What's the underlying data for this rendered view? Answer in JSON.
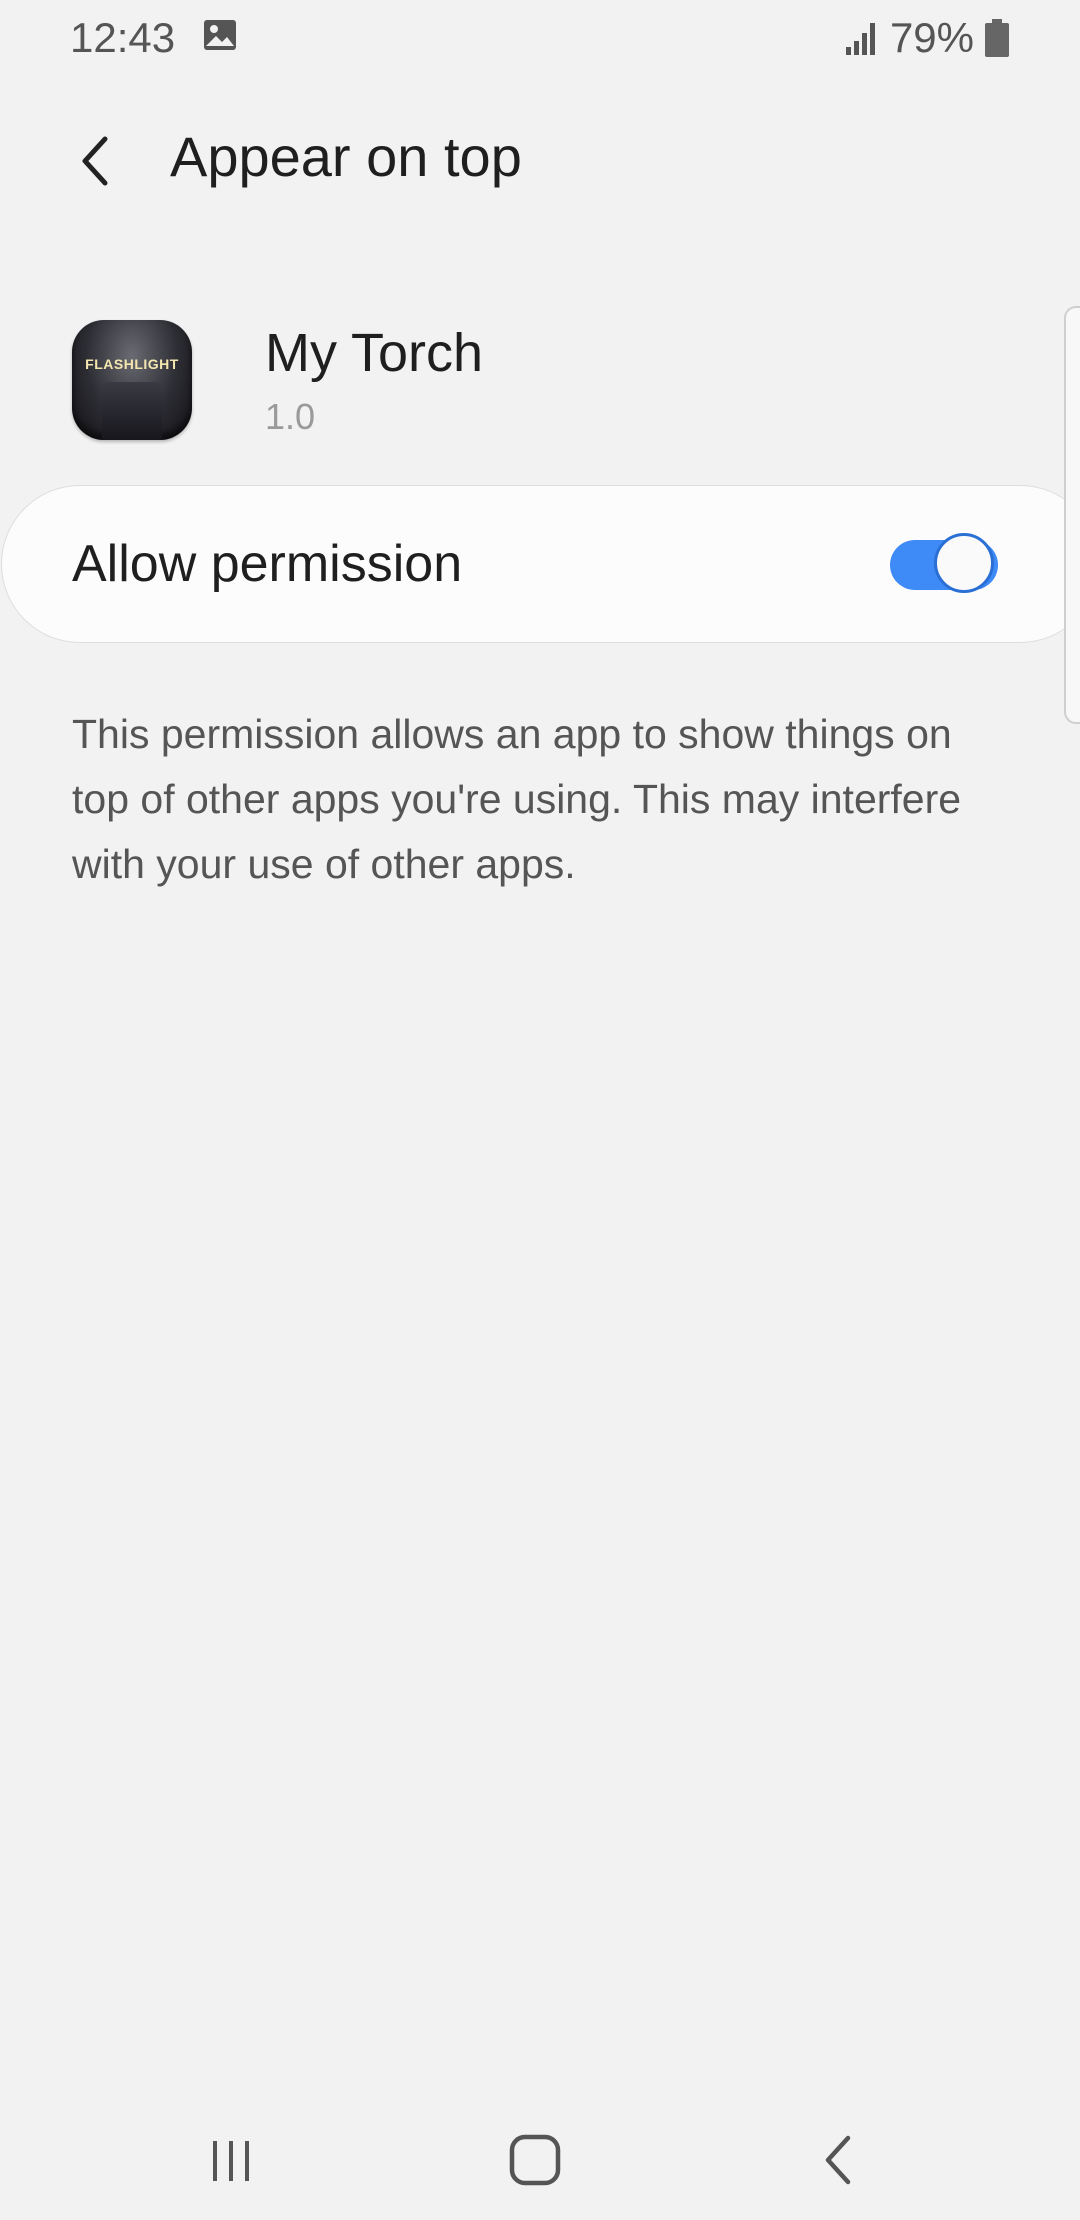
{
  "status_bar": {
    "time": "12:43",
    "battery": "79%",
    "icons": [
      "image-icon",
      "signal-icon",
      "battery-icon"
    ]
  },
  "header": {
    "title": "Appear on top"
  },
  "app": {
    "name": "My Torch",
    "version": "1.0",
    "icon_label": "FLASHLIGHT"
  },
  "permission": {
    "label": "Allow permission",
    "enabled": true
  },
  "description": "This permission allows an app to show things on top of other apps you're using. This may interfere with your use of other apps.",
  "colors": {
    "background": "#f2f2f2",
    "card": "#fcfcfc",
    "toggle_on": "#3e8af7",
    "text_primary": "#1f1f1f",
    "text_secondary": "#555555",
    "text_muted": "#9a9a9a"
  },
  "nav_bar": {
    "icons": [
      "recents-icon",
      "home-icon",
      "back-icon"
    ]
  }
}
